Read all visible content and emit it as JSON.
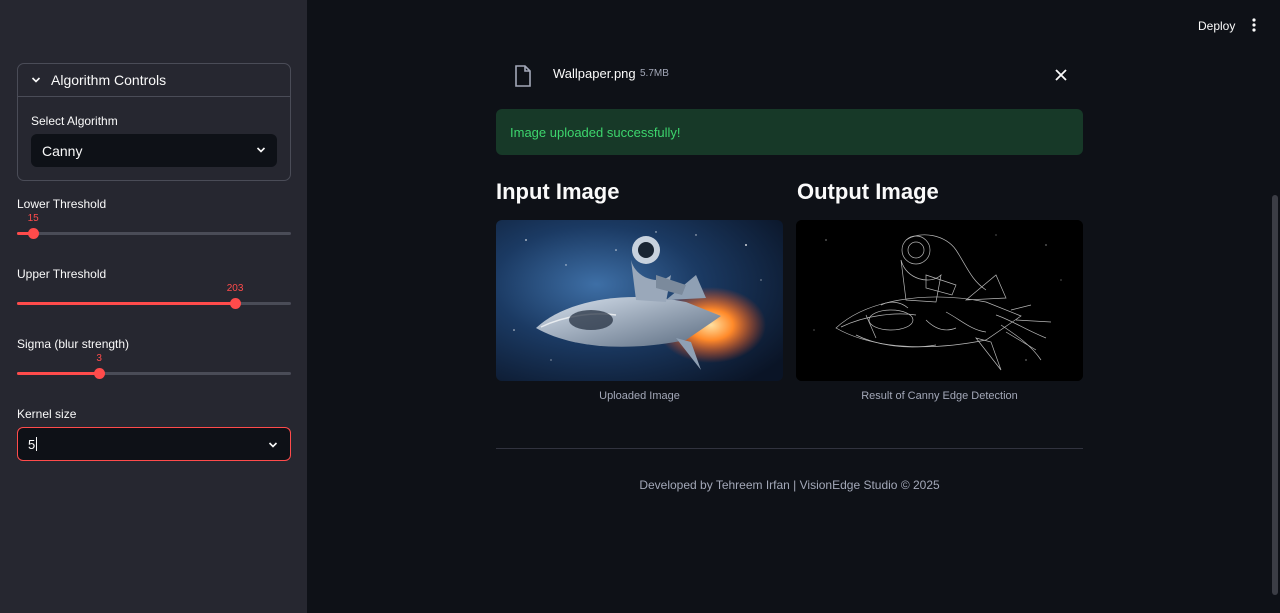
{
  "sidebar": {
    "expander": {
      "title": "Algorithm Controls"
    },
    "select_algorithm": {
      "label": "Select Algorithm",
      "value": "Canny"
    },
    "lower_threshold": {
      "label": "Lower Threshold",
      "value": "15",
      "fraction": 0.059
    },
    "upper_threshold": {
      "label": "Upper Threshold",
      "value": "203",
      "fraction": 0.796
    },
    "sigma": {
      "label": "Sigma (blur strength)",
      "value": "3",
      "fraction": 0.3
    },
    "kernel_size": {
      "label": "Kernel size",
      "value": "5"
    }
  },
  "header": {
    "deploy_label": "Deploy"
  },
  "uploader": {
    "file_name": "Wallpaper.png",
    "file_size": "5.7MB"
  },
  "alert": {
    "message": "Image uploaded successfully!"
  },
  "input_col": {
    "title": "Input Image",
    "caption": "Uploaded Image"
  },
  "output_col": {
    "title": "Output Image",
    "caption": "Result of Canny Edge Detection"
  },
  "footer": {
    "text": "Developed by Tehreem Irfan | VisionEdge Studio © 2025"
  },
  "colors": {
    "accent": "#ff4b4b",
    "success_text": "#3dd56d",
    "success_bg": "#173928",
    "sidebar_bg": "#262730",
    "main_bg": "#0e1117"
  }
}
